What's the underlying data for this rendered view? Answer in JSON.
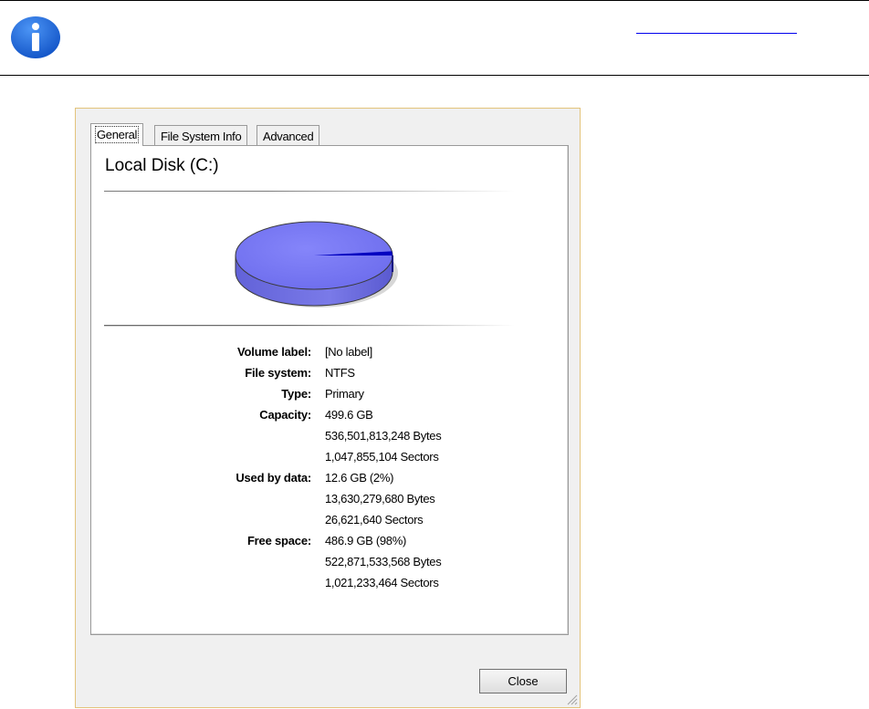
{
  "banner": {
    "icon": "info-icon",
    "link_text": ""
  },
  "dialog": {
    "tabs": [
      {
        "label": "General",
        "active": true
      },
      {
        "label": "File System Info",
        "active": false
      },
      {
        "label": "Advanced",
        "active": false
      }
    ],
    "title": "Local Disk (C:)",
    "usage": {
      "used_fraction": 0.02,
      "used_color": "#0000c0",
      "free_color": "#7b7bf5"
    },
    "properties": [
      {
        "label": "Volume label:",
        "values": [
          "[No label]"
        ]
      },
      {
        "label": "File system:",
        "values": [
          "NTFS"
        ]
      },
      {
        "label": "Type:",
        "values": [
          "Primary"
        ]
      },
      {
        "label": "Capacity:",
        "values": [
          "499.6 GB",
          "536,501,813,248 Bytes",
          "1,047,855,104 Sectors"
        ]
      },
      {
        "label": "Used by data:",
        "values": [
          "12.6 GB (2%)",
          "13,630,279,680 Bytes",
          "26,621,640 Sectors"
        ]
      },
      {
        "label": "Free space:",
        "values": [
          "486.9 GB (98%)",
          "522,871,533,568 Bytes",
          "1,021,233,464 Sectors"
        ]
      }
    ],
    "close_label": "Close"
  },
  "colors": {
    "info_icon_bg": "#1f6fe0",
    "dialog_border": "#e3c37b",
    "link": "#0000ee"
  }
}
